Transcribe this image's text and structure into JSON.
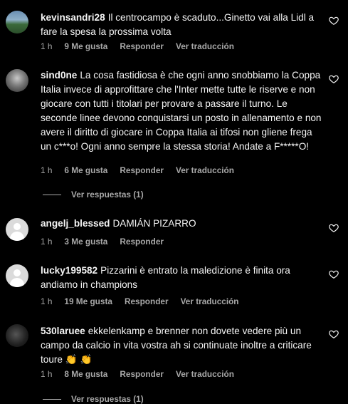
{
  "comments": [
    {
      "username": "kevinsandri28",
      "text": "Il centrocampo è scaduto...Ginetto vai alla Lidl a fare la spesa la prossima volta",
      "time": "1 h",
      "likes": "9 Me gusta",
      "reply": "Responder",
      "translate": "Ver traducción"
    },
    {
      "username": "sind0ne",
      "text": "La cosa fastidiosa è che ogni anno snobbiamo la Coppa Italia invece di approfittare che l'Inter mette tutte le riserve e non giocare con tutti i titolari per provare a passare il turno. Le seconde linee devono conquistarsi un posto in allenamento e non avere il diritto di giocare in Coppa Italia ai tifosi non gliene frega un c***o! Ogni anno sempre la stessa storia! Andate a F*****O!",
      "time": "1 h",
      "likes": "6 Me gusta",
      "reply": "Responder",
      "translate": "Ver traducción",
      "view_replies": "Ver respuestas (1)"
    },
    {
      "username": "angelj_blessed",
      "text": "DAMIÁN PIZARRO",
      "time": "1 h",
      "likes": "3 Me gusta",
      "reply": "Responder"
    },
    {
      "username": "lucky199582",
      "text": "Pizzarini è entrato la maledizione è finita ora andiamo in champions",
      "time": "1 h",
      "likes": "19 Me gusta",
      "reply": "Responder",
      "translate": "Ver traducción"
    },
    {
      "username": "530laruee",
      "text": "ekkelenkamp e brenner non dovete vedere più un campo da calcio in vita vostra ah si continuate inoltre a criticare toure 👏 👏",
      "time": "1 h",
      "likes": "8 Me gusta",
      "reply": "Responder",
      "translate": "Ver traducción",
      "view_replies": "Ver respuestas (1)"
    }
  ],
  "icons": {
    "like": "heart-outline-icon",
    "avatar_default": "default-user-icon"
  },
  "colors": {
    "background": "#000000",
    "text": "#f5f5f5",
    "secondary": "#a8a8a8"
  }
}
